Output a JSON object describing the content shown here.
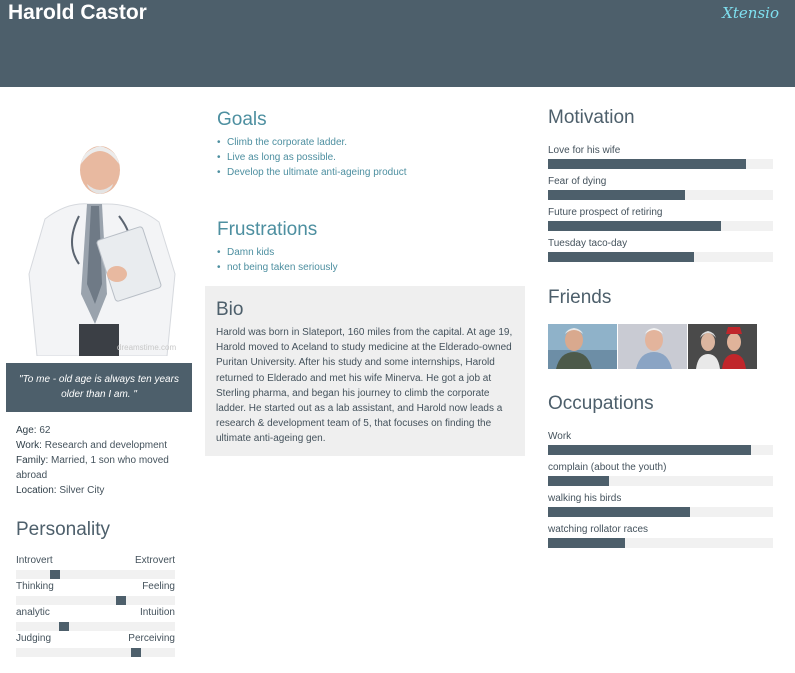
{
  "header": {
    "name": "Harold Castor",
    "brand": "Xtensio"
  },
  "photo": {
    "watermark": "dreamstime.com"
  },
  "quote": "\"To me - old age is always ten years older than I am. \"",
  "facts": [
    {
      "label": "Age:",
      "value": "62"
    },
    {
      "label": "Work:",
      "value": "Research and development"
    },
    {
      "label": "Family:",
      "value": "Married, 1 son who moved abroad"
    },
    {
      "label": "Location:",
      "value": "Silver City"
    }
  ],
  "personality": {
    "title": "Personality",
    "sliders": [
      {
        "left": "Introvert",
        "right": "Extrovert",
        "level": 0.23
      },
      {
        "left": "Thinking",
        "right": "Feeling",
        "level": 0.67
      },
      {
        "left": "analytic",
        "right": "Intuition",
        "level": 0.29
      },
      {
        "left": "Judging",
        "right": "Perceiving",
        "level": 0.77
      }
    ]
  },
  "goals": {
    "title": "Goals",
    "items": [
      "Climb the corporate ladder.",
      "Live as long as possible.",
      "Develop the ultimate anti-ageing product"
    ]
  },
  "frustrations": {
    "title": "Frustrations",
    "items": [
      "Damn kids",
      "not being taken seriously"
    ]
  },
  "bio": {
    "title": "Bio",
    "text": "Harold was born in Slateport, 160 miles from the capital. At age 19, Harold moved to Aceland to study medicine at the Elderado-owned Puritan University. After his study and some internships, Harold returned to Elderado and met his wife Minerva. He got a job at Sterling pharma, and began his journey to climb the corporate ladder. He started out as a lab assistant, and Harold now leads a research & development team of 5, that focuses on finding the ultimate anti-ageing gen."
  },
  "motivation": {
    "title": "Motivation",
    "items": [
      {
        "label": "Love for his wife",
        "level": 0.88
      },
      {
        "label": "Fear of dying",
        "level": 0.61
      },
      {
        "label": "Future prospect of retiring",
        "level": 0.77
      },
      {
        "label": "Tuesday taco-day",
        "level": 0.65
      }
    ]
  },
  "friends": {
    "title": "Friends"
  },
  "occupations": {
    "title": "Occupations",
    "items": [
      {
        "label": "Work",
        "level": 0.9
      },
      {
        "label": "complain (about the youth)",
        "level": 0.27
      },
      {
        "label": "walking his birds",
        "level": 0.63
      },
      {
        "label": "watching rollator races",
        "level": 0.34
      }
    ]
  },
  "colors": {
    "header": "#4d5f6b",
    "accent": "#4d8fa0",
    "track": "#f1f1f1",
    "brand": "#7fe0f0"
  }
}
